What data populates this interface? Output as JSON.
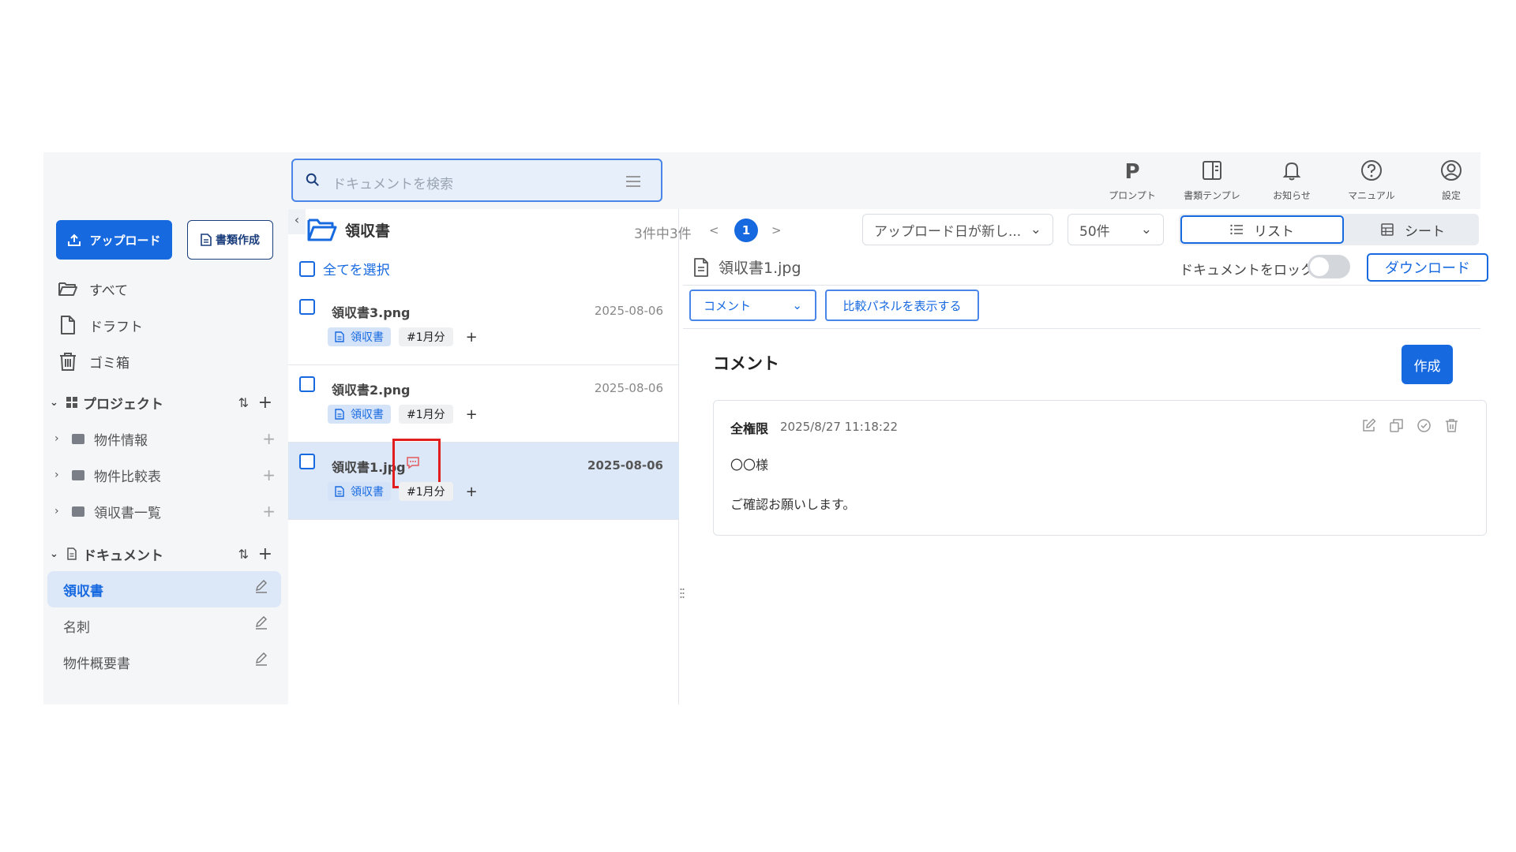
{
  "search": {
    "placeholder": "ドキュメントを検索"
  },
  "topnav": [
    {
      "label": "プロンプト",
      "icon": "prompt-p-icon"
    },
    {
      "label": "書類テンプレ",
      "icon": "template-icon"
    },
    {
      "label": "お知らせ",
      "icon": "bell-icon"
    },
    {
      "label": "マニュアル",
      "icon": "help-icon"
    },
    {
      "label": "設定",
      "icon": "user-circle-icon"
    }
  ],
  "sidebar": {
    "upload_label": "アップロード",
    "create_label": "書類作成",
    "nav": [
      {
        "label": "すべて",
        "icon": "folder-open-icon"
      },
      {
        "label": "ドラフト",
        "icon": "file-icon"
      },
      {
        "label": "ゴミ箱",
        "icon": "trash-icon"
      }
    ],
    "project_section": "プロジェクト",
    "projects": [
      "物件情報",
      "物件比較表",
      "領収書一覧"
    ],
    "document_section": "ドキュメント",
    "documents": [
      "領収書",
      "名刺",
      "物件概要書"
    ]
  },
  "list": {
    "folder_title": "領収書",
    "select_all": "全てを選択",
    "rows": [
      {
        "name": "領収書3.png",
        "date": "2025-08-06",
        "tag_doc": "領収書",
        "tag_hash": "#1月分"
      },
      {
        "name": "領収書2.png",
        "date": "2025-08-06",
        "tag_doc": "領収書",
        "tag_hash": "#1月分"
      },
      {
        "name": "領収書1.jpg",
        "date": "2025-08-06",
        "tag_doc": "領収書",
        "tag_hash": "#1月分"
      }
    ],
    "tag_add": "+"
  },
  "toolbar": {
    "count": "3件中3件",
    "prev": "<",
    "page": "1",
    "next": ">",
    "sort": "アップロード日が新し...",
    "per_page": "50件",
    "view_list": "リスト",
    "view_sheet": "シート"
  },
  "detail": {
    "file_name": "領収書1.jpg",
    "lock_label": "ドキュメントをロック",
    "lock_on": false,
    "download": "ダウンロード",
    "panel_select": "コメント",
    "compare_button": "比較パネルを表示する",
    "comments_title": "コメント",
    "new_button": "作成",
    "comment": {
      "author": "全権限",
      "time": "2025/8/27 11:18:22",
      "line1": "〇〇様",
      "line2": "ご確認お願いします。"
    }
  },
  "colors": {
    "accent": "#1769e0",
    "highlight": "#e21d1d",
    "selected_row": "#dce7f8"
  }
}
